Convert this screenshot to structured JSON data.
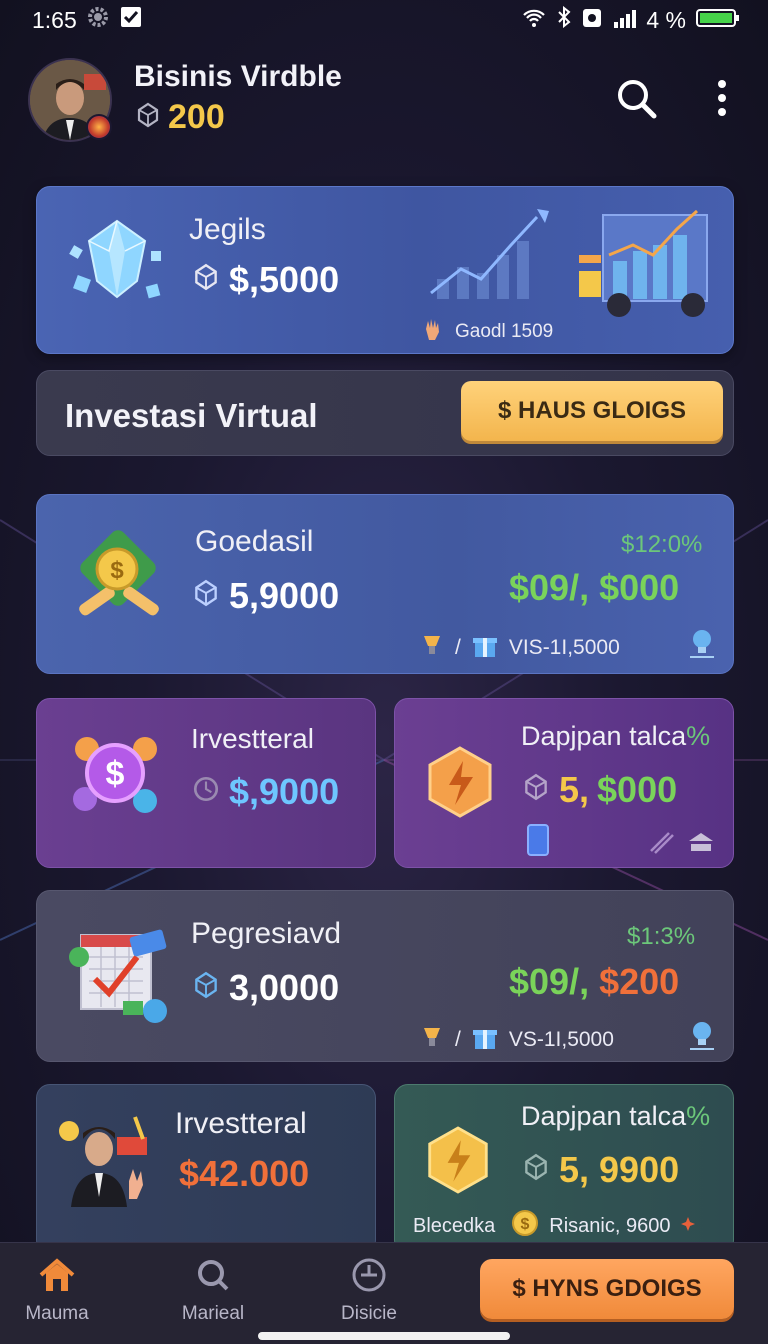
{
  "status_bar": {
    "time": "1:65",
    "battery": "4 %"
  },
  "header": {
    "title": "Bisinis Virdble",
    "coins": "200"
  },
  "hero": {
    "title": "Jegils",
    "amount": "$,5000",
    "meta": "Gaodl 1509"
  },
  "strip": {
    "title": "Investasi Virtual",
    "button": "$ HAUS GLOIGS"
  },
  "goedasil": {
    "title": "Goedasil",
    "amount": "5,9000",
    "pct": "$12:0%",
    "big": "$09/, $000",
    "meta": "VIS-1I,5000",
    "slash": "/"
  },
  "inv1": {
    "title": "Irvestteral",
    "amount": "$,9000"
  },
  "dap1": {
    "title": "Dapjpan talca",
    "pct_suffix": "%",
    "amount_a": "5,",
    "amount_b": "$000"
  },
  "peg": {
    "title": "Pegresiavd",
    "amount": "3,0000",
    "pct": "$1:3%",
    "big_a": "$09/,",
    "big_b": "$200",
    "meta": "VS-1I,5000",
    "slash": "/"
  },
  "inv2": {
    "title": "Irvestteral",
    "amount": "$42.000"
  },
  "dap2": {
    "title": "Dapjpan talca",
    "pct_suffix": "%",
    "amount": "5, 9900",
    "left_label": "Blecedka",
    "right_label": "Risanic, 9600"
  },
  "nav": {
    "items": [
      {
        "label": "Mauma"
      },
      {
        "label": "Marieal"
      },
      {
        "label": "Disicie"
      }
    ],
    "cta": "$ HYNS GDOIGS"
  }
}
